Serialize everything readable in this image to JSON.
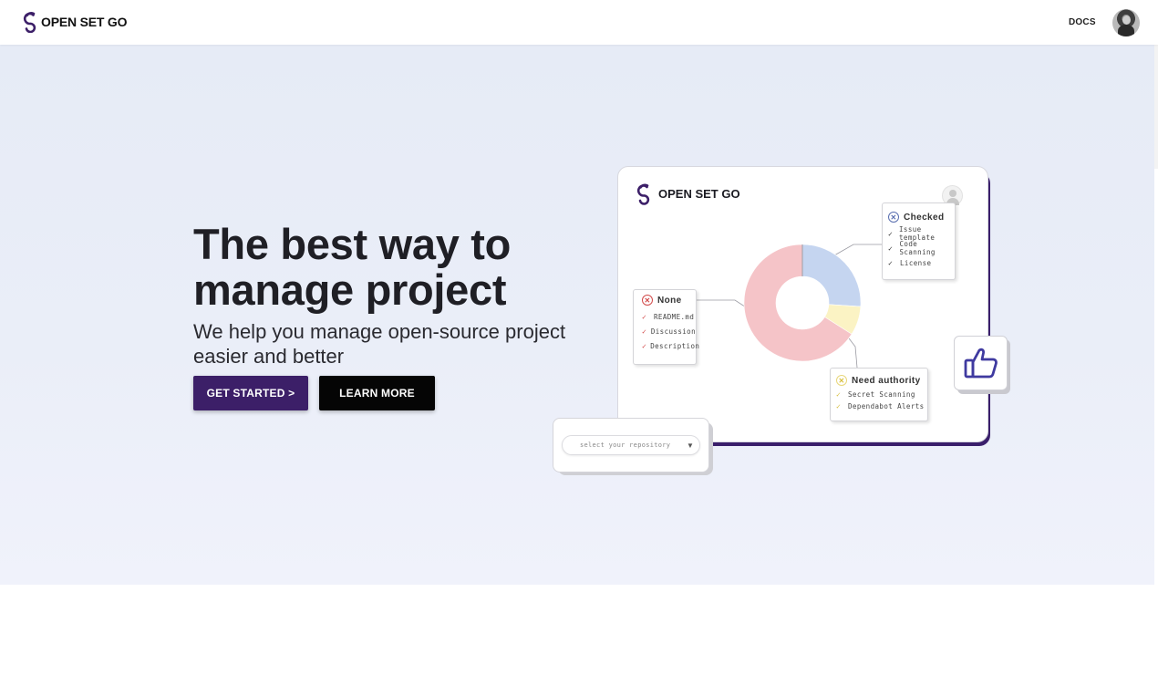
{
  "header": {
    "brand": "OPEN SET GO",
    "docs_label": "DOCS"
  },
  "hero": {
    "title": "The best way to manage project",
    "subtitle": "We help you manage open-source project easier and better",
    "primary_button": "GET STARTED >",
    "secondary_button": "LEARN MORE"
  },
  "illustration": {
    "brand": "OPEN SET GO",
    "checked": {
      "title": "Checked",
      "items": [
        "Issue template",
        "Code Scanning",
        "License"
      ]
    },
    "none": {
      "title": "None",
      "items": [
        "README.md",
        "Discussion",
        "Description"
      ]
    },
    "need_authority": {
      "title": "Need authority",
      "items": [
        "Secret Scanning",
        "Dependabot Alerts"
      ]
    },
    "select_placeholder": "select your repository",
    "donut": {
      "slices": [
        {
          "label": "Checked",
          "fraction": 0.26,
          "color": "#c5d5f0"
        },
        {
          "label": "Need authority",
          "fraction": 0.08,
          "color": "#fbf3c4"
        },
        {
          "label": "None",
          "fraction": 0.66,
          "color": "#f5c4c8"
        }
      ]
    }
  },
  "colors": {
    "brand_purple": "#3c1f68",
    "black_button": "#050505",
    "hero_bg": "#e8ecf7"
  },
  "progress": 0.2
}
